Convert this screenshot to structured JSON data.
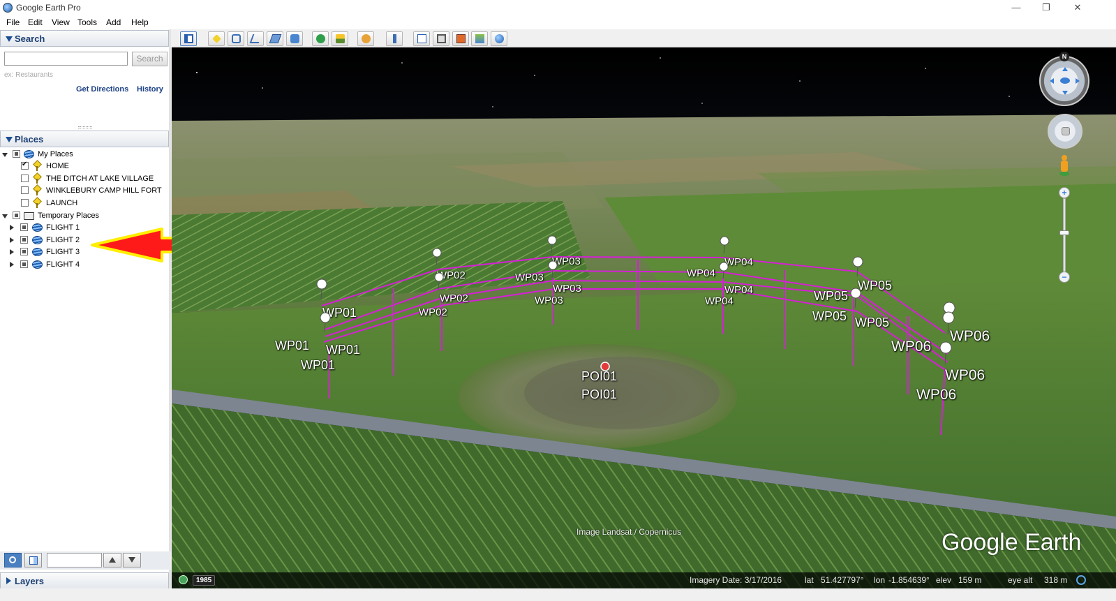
{
  "window": {
    "title": "Google Earth Pro",
    "minimize": "—",
    "maximize": "❐",
    "close": "✕"
  },
  "menu": [
    "File",
    "Edit",
    "View",
    "Tools",
    "Add",
    "Help"
  ],
  "toolbar": {
    "icons": [
      "sidebar-toggle-icon",
      "placemark-icon",
      "polygon-icon",
      "path-icon",
      "image-overlay-icon",
      "tour-icon",
      "historical-imagery-icon",
      "sunlight-icon",
      "planets-icon",
      "ruler-icon",
      "email-icon",
      "print-icon",
      "save-image-icon",
      "google-maps-icon",
      "earth-icon"
    ]
  },
  "search": {
    "header": "Search",
    "placeholder": "",
    "button": "Search",
    "hint": "ex: Restaurants",
    "get_directions": "Get Directions",
    "history": "History"
  },
  "places": {
    "header": "Places",
    "my_places": "My Places",
    "items": [
      {
        "label": "HOME",
        "checked": true
      },
      {
        "label": "THE DITCH AT LAKE VILLAGE",
        "checked": false
      },
      {
        "label": "WINKLEBURY CAMP HILL FORT",
        "checked": false
      },
      {
        "label": "LAUNCH",
        "checked": false
      }
    ],
    "temporary_places": "Temporary Places",
    "flights": [
      "FLIGHT 1",
      "FLIGHT 2",
      "FLIGHT 3",
      "FLIGHT 4"
    ]
  },
  "layers": {
    "header": "Layers"
  },
  "map": {
    "waypoints": [
      "WP01",
      "WP01",
      "WP01",
      "WP01",
      "WP02",
      "WP02",
      "WP02",
      "WP03",
      "WP03",
      "WP03",
      "WP03",
      "WP04",
      "WP04",
      "WP04",
      "WP04",
      "WP05",
      "WP05",
      "WP05",
      "WP05",
      "WP06",
      "WP06",
      "WP06",
      "WP06"
    ],
    "poi": [
      "POI01",
      "POI01"
    ],
    "credit": "Image Landsat / Copernicus",
    "brand": "Google Earth",
    "compass_north": "N",
    "path_color": "#d61fd6",
    "arrow_color": "#ff1a1a",
    "arrow_outline": "#ffee00"
  },
  "status": {
    "year": "1985",
    "imagery_date": "Imagery Date: 3/17/2016",
    "lat_label": "lat",
    "lat": "51.427797°",
    "lon_label": "lon",
    "lon": "-1.854639°",
    "elev_label": "elev",
    "elev": "159 m",
    "eye_alt_label": "eye alt",
    "eye_alt": "318 m"
  }
}
